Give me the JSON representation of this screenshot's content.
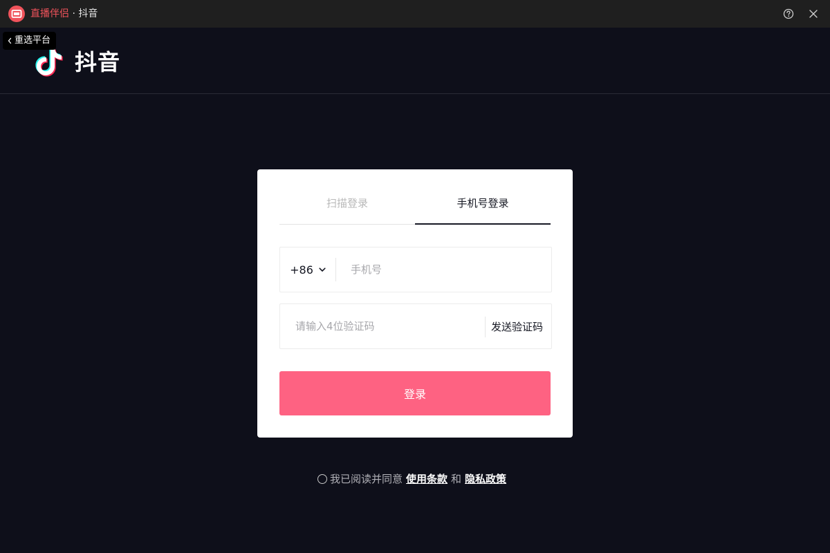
{
  "window": {
    "app_name": "直播伴侣",
    "separator": "·",
    "platform_name": "抖音"
  },
  "header": {
    "back_label": "重选平台",
    "logo_text": "抖音"
  },
  "login": {
    "tabs": [
      {
        "label": "扫描登录",
        "active": false
      },
      {
        "label": "手机号登录",
        "active": true
      }
    ],
    "country_code": "+86",
    "phone_placeholder": "手机号",
    "code_placeholder": "请输入4位验证码",
    "send_code_label": "发送验证码",
    "submit_label": "登录"
  },
  "agreement": {
    "text": "我已阅读并同意",
    "terms_label": "使用条款",
    "and_label": "和",
    "privacy_label": "隐私政策"
  },
  "colors": {
    "background": "#0e0f1a",
    "titlebar": "#1f1f1f",
    "brand_red": "#f0535b",
    "login_button": "#fe6282",
    "tiktok_cyan": "#25f4ee",
    "tiktok_pink": "#fe2c55"
  },
  "icons": {
    "app": "live-companion-icon",
    "help": "help-icon",
    "close": "close-icon",
    "back": "chevron-left-icon",
    "logo": "douyin-logo-icon",
    "dropdown": "chevron-down-icon"
  }
}
